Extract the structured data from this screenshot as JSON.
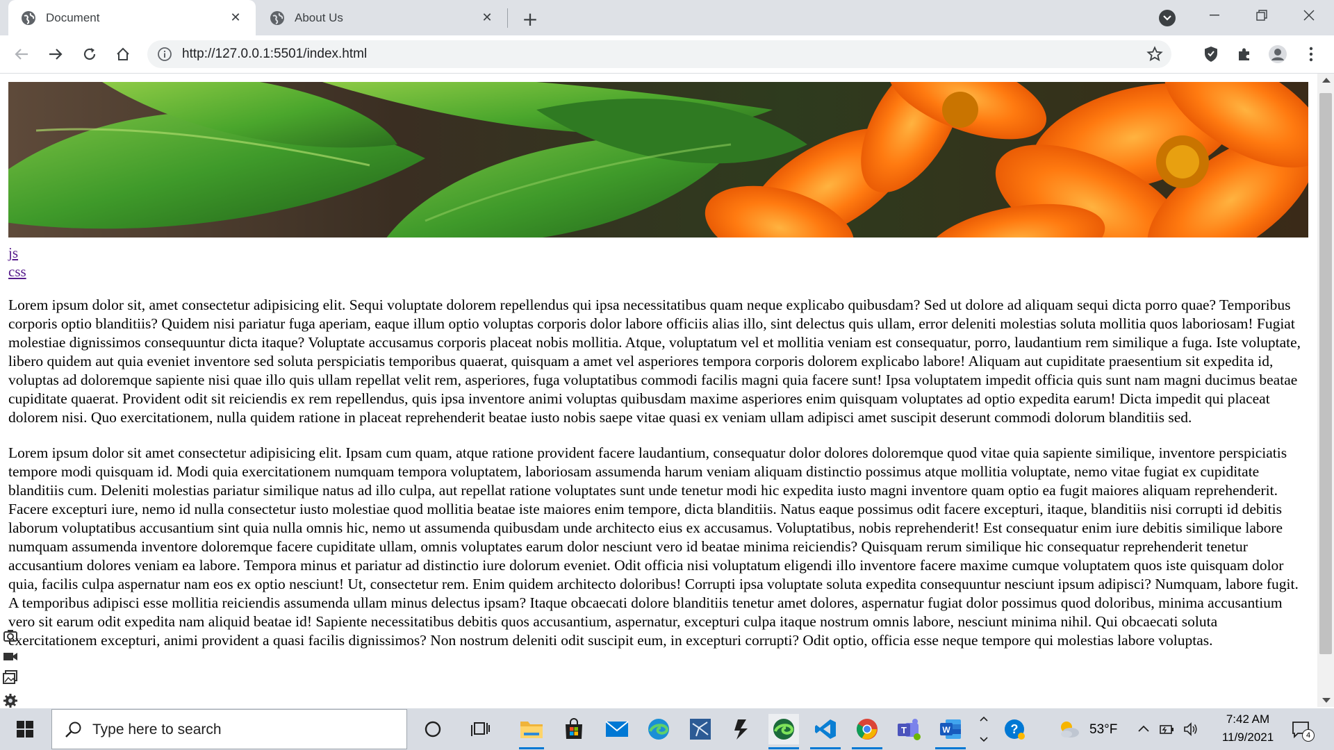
{
  "browser": {
    "tabs": [
      {
        "title": "Document",
        "active": true
      },
      {
        "title": "About Us",
        "active": false
      }
    ],
    "url": "http://127.0.0.1:5501/index.html"
  },
  "page": {
    "banner_image": "leaves-and-orange-flowers-banner",
    "links": [
      "js",
      "css"
    ],
    "paragraphs": [
      "Lorem ipsum dolor sit, amet consectetur adipisicing elit. Sequi voluptate dolorem repellendus qui ipsa necessitatibus quam neque explicabo quibusdam? Sed ut dolore ad aliquam sequi dicta porro quae? Temporibus corporis optio blanditiis? Quidem nisi pariatur fuga aperiam, eaque illum optio voluptas corporis dolor labore officiis alias illo, sint delectus quis ullam, error deleniti molestias soluta mollitia quos laboriosam! Fugiat molestiae dignissimos consequuntur dicta itaque? Voluptate accusamus corporis placeat nobis mollitia. Atque, voluptatum vel et mollitia veniam est consequatur, porro, laudantium rem similique a fuga. Iste voluptate, libero quidem aut quia eveniet inventore sed soluta perspiciatis temporibus quaerat, quisquam a amet vel asperiores tempora corporis dolorem explicabo labore! Aliquam aut cupiditate praesentium sit expedita id, voluptas ad doloremque sapiente nisi quae illo quis ullam repellat velit rem, asperiores, fuga voluptatibus commodi facilis magni quia facere sunt! Ipsa voluptatem impedit officia quis sunt nam magni ducimus beatae cupiditate quaerat. Provident odit sit reiciendis ex rem repellendus, quis ipsa inventore animi voluptas quibusdam maxime asperiores enim quisquam voluptates ad optio expedita earum! Dicta impedit qui placeat dolorem nisi. Quo exercitationem, nulla quidem ratione in placeat reprehenderit beatae iusto nobis saepe vitae quasi ex veniam ullam adipisci amet suscipit deserunt commodi dolorum blanditiis sed.",
      "Lorem ipsum dolor sit amet consectetur adipisicing elit. Ipsam cum quam, atque ratione provident facere laudantium, consequatur dolor dolores doloremque quod vitae quia sapiente similique, inventore perspiciatis tempore modi quisquam id. Modi quia exercitationem numquam tempora voluptatem, laboriosam assumenda harum veniam aliquam distinctio possimus atque mollitia voluptate, nemo vitae fugiat ex cupiditate blanditiis cum. Deleniti molestias pariatur similique natus ad illo culpa, aut repellat ratione voluptates sunt unde tenetur modi hic expedita iusto magni inventore quam optio ea fugit maiores aliquam reprehenderit. Facere excepturi iure, nemo id nulla consectetur iusto molestiae quod mollitia beatae iste maiores enim tempore, dicta blanditiis. Natus eaque possimus odit facere excepturi, itaque, blanditiis nisi corrupti id debitis laborum voluptatibus accusantium sint quia nulla omnis hic, nemo ut assumenda quibusdam unde architecto eius ex accusamus. Voluptatibus, nobis reprehenderit! Est consequatur enim iure debitis similique labore numquam assumenda inventore doloremque facere cupiditate ullam, omnis voluptates earum dolor nesciunt vero id beatae minima reiciendis? Quisquam rerum similique hic consequatur reprehenderit tenetur accusantium dolores veniam ea labore. Tempora minus et pariatur ad distinctio iure dolorum eveniet. Odit officia nisi voluptatum eligendi illo inventore facere maxime cumque voluptatem quos iste quisquam dolor quia, facilis culpa aspernatur nam eos ex optio nesciunt! Ut, consectetur rem. Enim quidem architecto doloribus! Corrupti ipsa voluptate soluta expedita consequuntur nesciunt ipsum adipisci? Numquam, labore fugit. A temporibus adipisci esse mollitia reiciendis assumenda ullam minus delectus ipsam? Itaque obcaecati dolore blanditiis tenetur amet dolores, aspernatur fugiat dolor possimus quod doloribus, minima accusantium vero sit earum odit expedita nam aliquid beatae id! Sapiente necessitatibus debitis quos accusantium, aspernatur, excepturi culpa itaque nostrum omnis labore, nesciunt minima nihil. Qui obcaecati soluta exercitationem excepturi, animi provident a quasi facilis dignissimos? Non nostrum deleniti odit suscipit eum, in excepturi corrupti? Odit optio, officia esse neque tempore qui molestias labore voluptas."
    ]
  },
  "taskbar": {
    "search_placeholder": "Type here to search",
    "weather_temp": "53°F",
    "time": "7:42 AM",
    "date": "11/9/2021",
    "notification_count": "4",
    "pinned_apps": [
      "cortana-icon",
      "task-view-icon",
      "file-explorer-icon",
      "microsoft-store-icon",
      "mail-icon",
      "edge-icon",
      "app-icon",
      "visual-studio-icon",
      "edge-dev-icon",
      "vscode-icon",
      "chrome-icon",
      "teams-icon",
      "word-icon"
    ]
  },
  "colors": {
    "tabstrip": "#dee1e6",
    "link": "#551a8b",
    "taskbar": "#d8dce3",
    "accent": "#0078d4"
  }
}
